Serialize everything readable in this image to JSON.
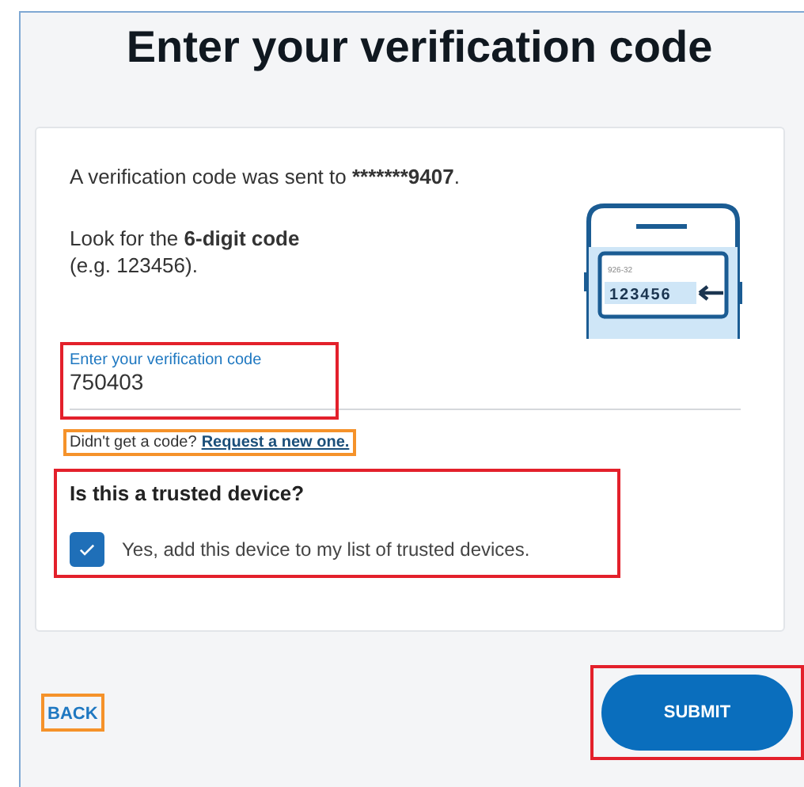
{
  "title": "Enter your verification code",
  "message": {
    "parts": [
      {
        "text": "A verification code was sent to ",
        "bold": false
      },
      {
        "text": "*******9407",
        "bold": true
      },
      {
        "text": ".",
        "bold": false
      }
    ]
  },
  "hint": {
    "text": "Look for the **6-digit code**\n(e.g. 123456)."
  },
  "illustration": {
    "kind": "phone",
    "sender": "926-32",
    "code": "123456"
  },
  "code_field": {
    "label": "Enter your verification code",
    "value": "750403",
    "color": "#e3202b"
  },
  "resend": {
    "text": "Didn't get a code?",
    "link": "Request a new one.",
    "color": "#f5922a"
  },
  "trusted": {
    "heading": "Is this a trusted device?",
    "label": "Yes, add this device to my list of trusted devices.",
    "checked": true,
    "color": "#e3202b"
  },
  "back": {
    "label": "BACK",
    "color": "#f5922a"
  },
  "submit": {
    "label": "SUBMIT",
    "color": "#e3202b"
  }
}
